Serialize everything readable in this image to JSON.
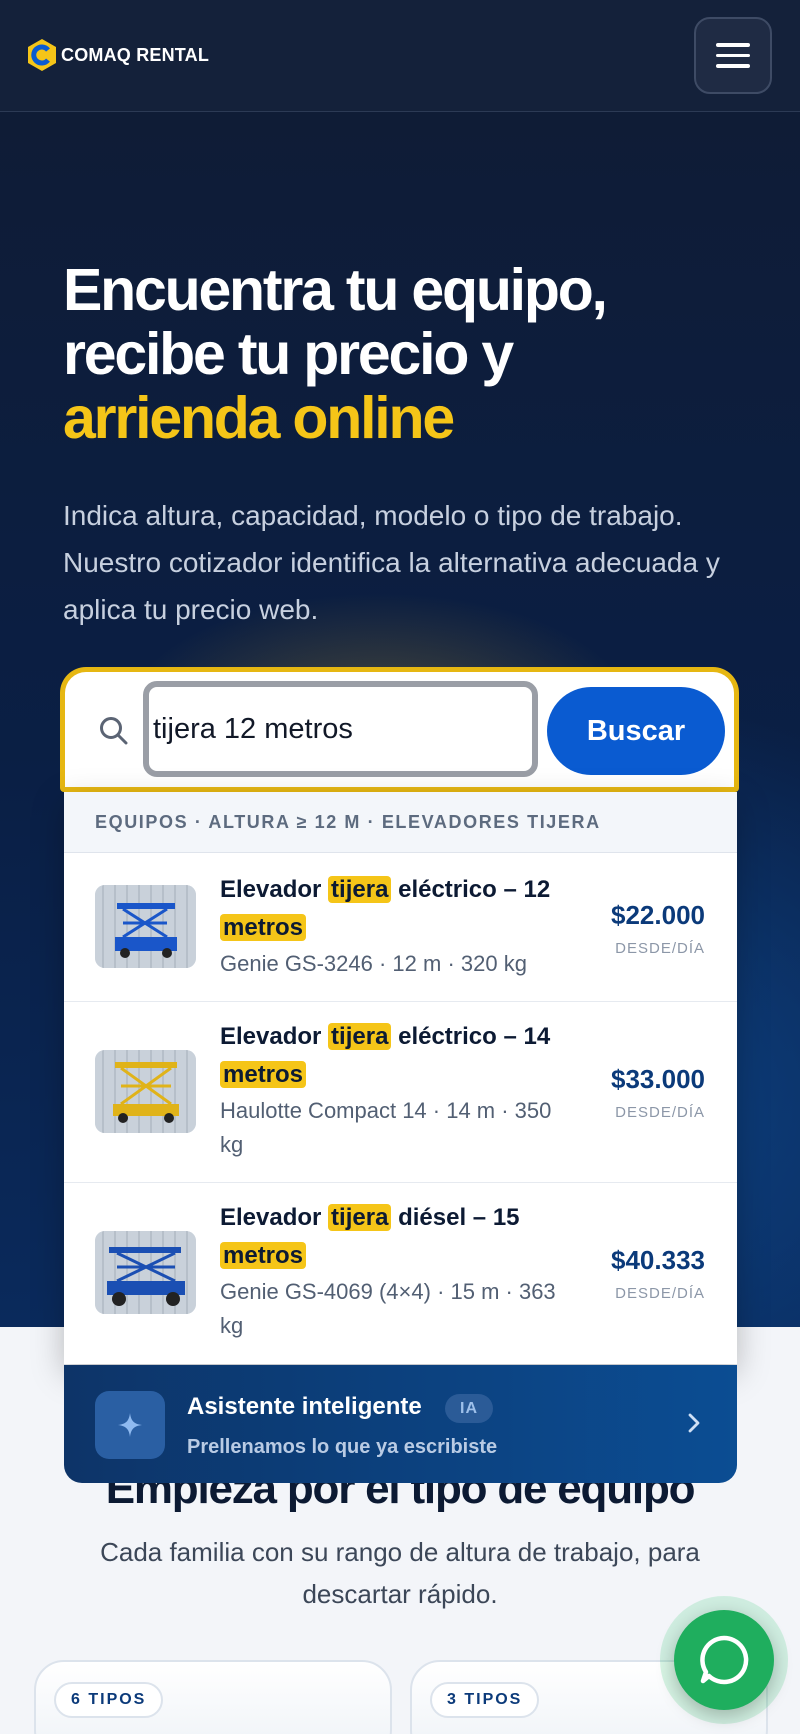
{
  "header": {
    "brand": "COMAQ RENTAL",
    "logo_icon": "comaq-logo-icon",
    "menu_icon": "hamburger-menu-icon"
  },
  "hero": {
    "title_line1": "Encuentra tu equipo,",
    "title_line2": "recibe tu precio y",
    "title_highlight": "arrienda online",
    "subtitle": "Indica altura, capacidad, modelo o tipo de trabajo. Nuestro cotizador identifica la alternativa adecuada y aplica tu precio web."
  },
  "search": {
    "icon": "search-icon",
    "value": "tijera 12 metros",
    "button_label": "Buscar"
  },
  "results": {
    "header": "EQUIPOS · ALTURA ≥ 12 M · ELEVADORES TIJERA",
    "items": [
      {
        "title_pre": "Elevador ",
        "title_mark1": "tijera",
        "title_mid": " eléctrico – 12 ",
        "title_mark2": "metros",
        "meta": "Genie GS-3246 · 12 m · 320 kg",
        "price": "$22.000",
        "unit": "DESDE/DÍA",
        "image": "blue-scissor-lift-image"
      },
      {
        "title_pre": "Elevador ",
        "title_mark1": "tijera",
        "title_mid": " eléctrico – 14 ",
        "title_mark2": "metros",
        "meta": "Haulotte Compact 14 · 14 m · 350 kg",
        "price": "$33.000",
        "unit": "DESDE/DÍA",
        "image": "yellow-scissor-lift-image"
      },
      {
        "title_pre": "Elevador ",
        "title_mark1": "tijera",
        "title_mid": " diésel – 15 ",
        "title_mark2": "metros",
        "meta": "Genie GS-4069 (4×4) · 15 m · 363 kg",
        "price": "$40.333",
        "unit": "DESDE/DÍA",
        "image": "blue-diesel-scissor-lift-image"
      }
    ]
  },
  "assistant": {
    "icon": "sparkle-icon",
    "title": "Asistente inteligente",
    "badge": "IA",
    "subtitle": "Prellenamos lo que ya escribiste",
    "chevron": "chevron-right-icon"
  },
  "categories": {
    "title": "Empieza por el tipo de equipo",
    "subtitle": "Cada familia con su rango de altura de trabajo, para descartar rápido.",
    "cards": [
      {
        "badge": "6 TIPOS"
      },
      {
        "badge": "3 TIPOS"
      }
    ]
  },
  "whatsapp": {
    "icon": "whatsapp-icon"
  },
  "colors": {
    "header_bg": "#14213a",
    "hero_bg": "#0a1f45",
    "accent_yellow": "#f5c518",
    "primary_blue": "#0a5bd1",
    "price_blue": "#0b3a7a",
    "whatsapp_green": "#1fae5e"
  }
}
